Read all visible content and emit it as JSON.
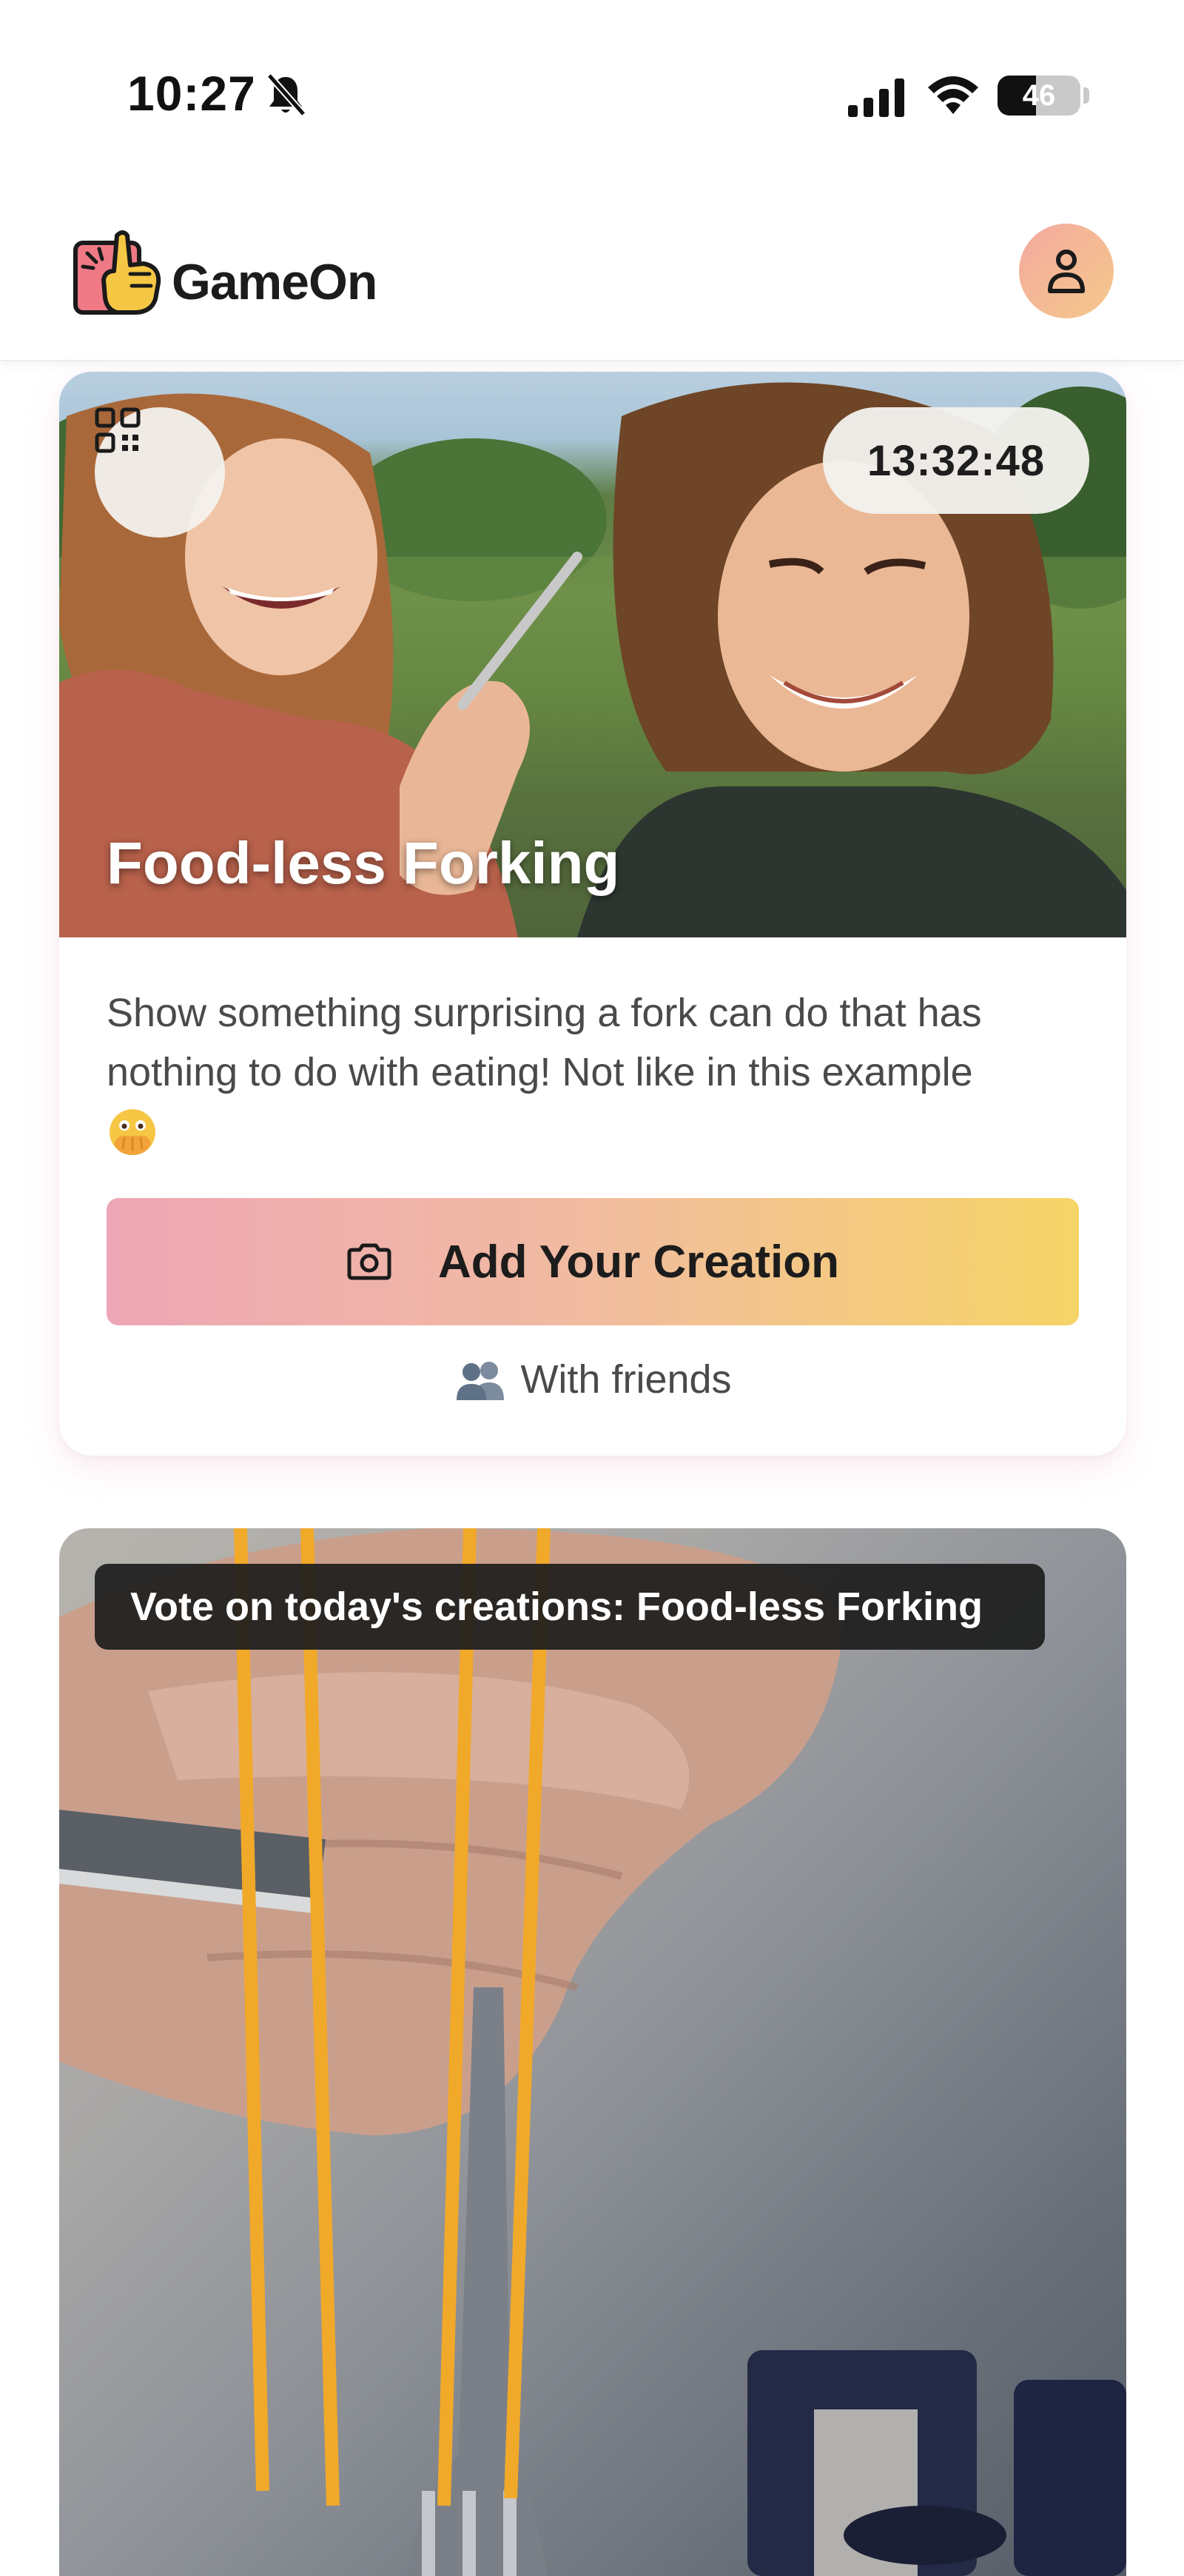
{
  "status_bar": {
    "time": "10:27",
    "battery_level": "46",
    "battery_fraction": 0.46
  },
  "header": {
    "app_name": "GameOn",
    "logo_icon": "pointing-hand-logo-icon",
    "profile_icon": "person-icon"
  },
  "challenge": {
    "title": "Food-less Forking",
    "timer": "13:32:48",
    "description": "Show something surprising a fork can do that has nothing to do with eating! Not like in this example",
    "emoji_icon": "face-with-open-eyes-and-hand-over-mouth",
    "add_button_label": "Add Your Creation",
    "with_friends_label": "With friends"
  },
  "vote": {
    "banner": "Vote on today's creations: Food-less Forking"
  },
  "colors": {
    "gradient_start": "#eda6b5",
    "gradient_end": "#f6d466",
    "avatar_start": "#f3a9a0",
    "avatar_end": "#f5c98a",
    "banner_bg": "#1c1c1c"
  }
}
